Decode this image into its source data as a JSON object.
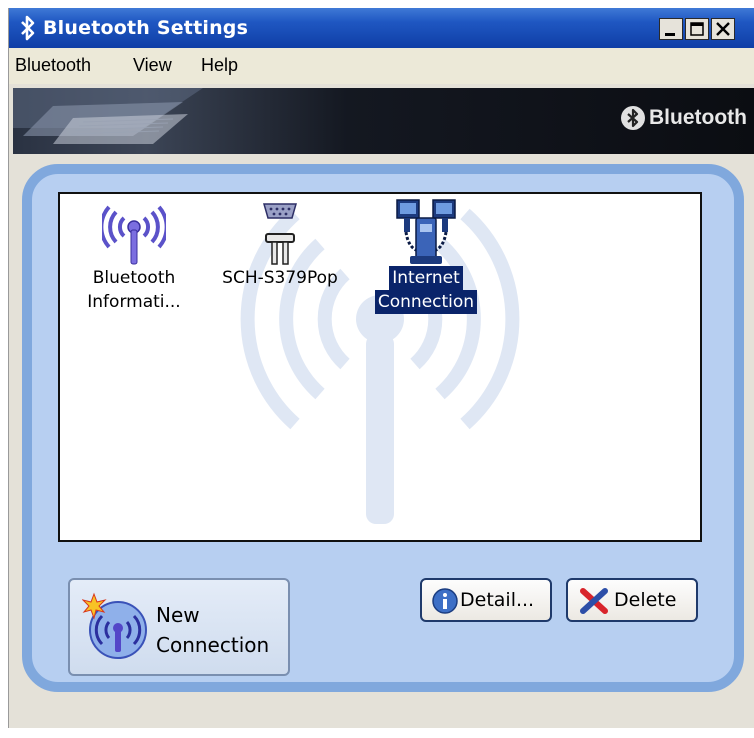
{
  "window": {
    "title": "Bluetooth Settings",
    "controls": [
      "minimize",
      "maximize",
      "close"
    ]
  },
  "menu": {
    "items": [
      "Bluetooth",
      "View",
      "Help"
    ]
  },
  "banner": {
    "brand": "Bluetooth",
    "brand_icon": "bluetooth-logo-icon"
  },
  "connections": [
    {
      "label_line1": "Bluetooth",
      "label_line2": "Informati...",
      "icon": "antenna-icon",
      "selected": false
    },
    {
      "label_line1": "SCH-S379Pop",
      "label_line2": "",
      "icon": "serial-port-icon",
      "selected": false
    },
    {
      "label_line1": "Internet",
      "label_line2": "Connection",
      "icon": "network-computers-icon",
      "selected": true
    }
  ],
  "buttons": {
    "new_connection_line1": "New",
    "new_connection_line2": "Connection",
    "detail": "Detail...",
    "delete": "Delete"
  },
  "colors": {
    "titlebar": "#1f57c2",
    "panel_fill": "#b7cff1",
    "panel_border": "#80a8dd",
    "selection": "#0a246a"
  }
}
